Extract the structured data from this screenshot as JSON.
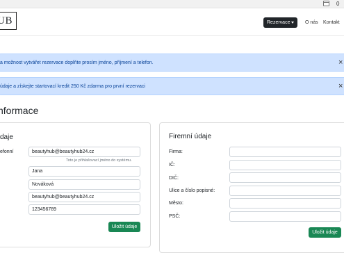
{
  "topbar": {
    "count": "0"
  },
  "navbar": {
    "logo_text": "UB",
    "reservation_button": "Rezervace",
    "link_about": "O nás",
    "link_contact": "Kontakt"
  },
  "alerts": [
    {
      "text": "a možnost vytvářet rezervace doplňte prosím jméno, příjmení a telefon.",
      "close": "×"
    },
    {
      "text": "údaje a získejte startovací kredit 250 Kč zdarma pro první rezervaci",
      "close": "×"
    }
  ],
  "page_title": "nformace",
  "personal": {
    "title": "daje",
    "login_label": "efonní",
    "login_value": "beautyhub@beautyhub24.cz",
    "login_help": "Toto je přihlašovací jméno do systému.",
    "first_name": "Jana",
    "last_name": "Nováková",
    "email": "beautyhub@beautyhub24.cz",
    "phone": "123456789",
    "save_button": "Uložit údaje"
  },
  "company": {
    "title": "Firemní údaje",
    "labels": [
      "Firma:",
      "IČ:",
      "DIČ:",
      "Ulice a číslo popisné:",
      "Město:",
      "PSČ:"
    ],
    "values": [
      "",
      "",
      "",
      "",
      "",
      ""
    ],
    "save_button": "Uložit údaje"
  }
}
